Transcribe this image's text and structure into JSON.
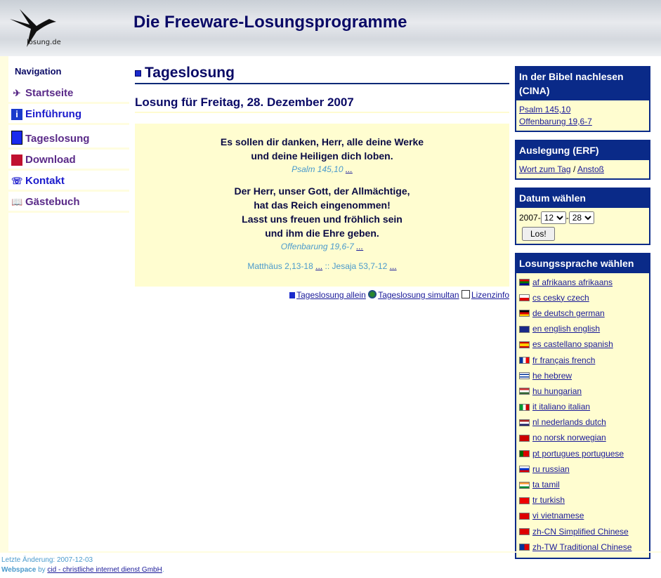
{
  "header": {
    "title": "Die Freeware-Losungsprogramme",
    "logo_text": "losung.de"
  },
  "nav": {
    "heading": "Navigation",
    "items": [
      {
        "label": "Startseite",
        "icon": "bird-icon"
      },
      {
        "label": "Einführung",
        "icon": "info-icon"
      },
      {
        "label": "Tageslosung",
        "icon": "book-icon"
      },
      {
        "label": "Download",
        "icon": "floppy-disk-icon"
      },
      {
        "label": "Kontakt",
        "icon": "contact-icon"
      },
      {
        "label": "Gästebuch",
        "icon": "open-book-icon"
      }
    ]
  },
  "main": {
    "heading": "Tageslosung",
    "subheading": "Losung für Freitag, 28. Dezember 2007",
    "verse1": [
      "Es sollen dir danken, Herr, alle deine Werke",
      "und deine Heiligen dich loben."
    ],
    "ref1": "Psalm 145,10",
    "more": "...",
    "verse2": [
      "Der Herr, unser Gott, der Allmächtige,",
      "hat das Reich eingenommen!",
      "Lasst uns freuen und fröhlich sein",
      "und ihm die Ehre geben."
    ],
    "ref2": "Offenbarung 19,6-7",
    "reading1": "Matthäus 2,13-18",
    "separator": "::",
    "reading2": "Jesaja 53,7-12",
    "links": [
      "Tageslosung allein",
      "Tageslosung simultan",
      "Lizenzinfo"
    ]
  },
  "right": {
    "bible": {
      "title": "In der Bibel nachlesen (CINA)",
      "links": [
        "Psalm 145,10",
        "Offenbarung 19,6-7"
      ]
    },
    "erf": {
      "title": "Auslegung (ERF)",
      "link1": "Wort zum Tag",
      "sep": "/",
      "link2": "Anstoß"
    },
    "date": {
      "title": "Datum wählen",
      "year": "2007-",
      "month": "12",
      "dash": "-",
      "day": "28",
      "button": "Los!"
    },
    "lang": {
      "title": "Losungssprache wählen",
      "items": [
        {
          "label": "af afrikaans afrikaans",
          "flag": "za"
        },
        {
          "label": "cs cesky czech",
          "flag": "cz"
        },
        {
          "label": "de deutsch german",
          "flag": "de"
        },
        {
          "label": "en english english",
          "flag": "gb"
        },
        {
          "label": "es castellano spanish",
          "flag": "es"
        },
        {
          "label": "fr français french",
          "flag": "fr"
        },
        {
          "label": "he hebrew",
          "flag": "il"
        },
        {
          "label": "hu hungarian",
          "flag": "hu"
        },
        {
          "label": "it italiano italian",
          "flag": "it"
        },
        {
          "label": "nl nederlands dutch",
          "flag": "nl"
        },
        {
          "label": "no norsk norwegian",
          "flag": "no"
        },
        {
          "label": "pt portugues portuguese",
          "flag": "pt"
        },
        {
          "label": "ru russian",
          "flag": "ru"
        },
        {
          "label": "ta tamil",
          "flag": "in"
        },
        {
          "label": "tr turkish",
          "flag": "tr"
        },
        {
          "label": "vi vietnamese",
          "flag": "vn"
        },
        {
          "label": "zh-CN Simplified Chinese",
          "flag": "cn"
        },
        {
          "label": "zh-TW Traditional Chinese",
          "flag": "tw"
        }
      ]
    }
  },
  "footer": {
    "changed": "Letzte Änderung: 2007-12-03",
    "webspace": "Webspace",
    "by": "by",
    "provider": "cid - christliche internet dienst GmbH",
    "dot": "."
  }
}
